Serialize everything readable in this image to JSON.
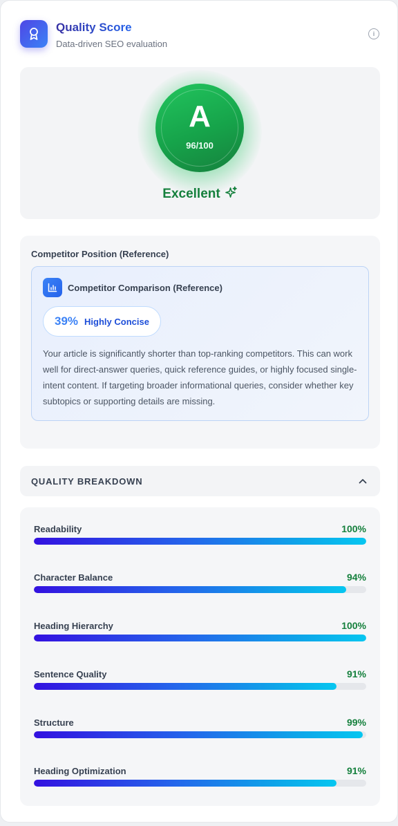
{
  "header": {
    "title": "Quality Score",
    "subtitle": "Data-driven SEO evaluation",
    "icon": "award-ribbon-icon"
  },
  "score": {
    "grade": "A",
    "points": "96/100",
    "rating": "Excellent",
    "color": "#16a34a"
  },
  "competitor": {
    "section_heading": "Competitor Position (Reference)",
    "card_title": "Competitor Comparison (Reference)",
    "percent": "39%",
    "badge_label": "Highly Concise",
    "description": "Your article is significantly shorter than top-ranking competitors. This can work well for direct-answer queries, quick reference guides, or highly focused single-intent content. If targeting broader informational queries, consider whether key subtopics or supporting details are missing."
  },
  "breakdown": {
    "title": "QUALITY BREAKDOWN",
    "expanded": true,
    "metrics": [
      {
        "label": "Readability",
        "value": "100%",
        "fraction": 1.0
      },
      {
        "label": "Character Balance",
        "value": "94%",
        "fraction": 0.94
      },
      {
        "label": "Heading Hierarchy",
        "value": "100%",
        "fraction": 1.0
      },
      {
        "label": "Sentence Quality",
        "value": "91%",
        "fraction": 0.91
      },
      {
        "label": "Structure",
        "value": "99%",
        "fraction": 0.99
      },
      {
        "label": "Heading Optimization",
        "value": "91%",
        "fraction": 0.91
      }
    ]
  }
}
